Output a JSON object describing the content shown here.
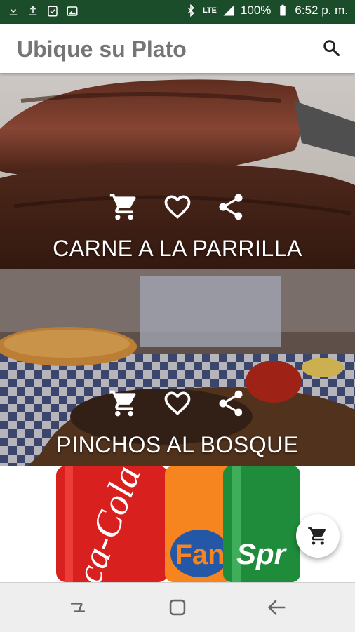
{
  "status_bar": {
    "network": "LTE",
    "battery": "100%",
    "time": "6:52 p. m."
  },
  "app_bar": {
    "title": "Ubique su Plato"
  },
  "dishes": [
    {
      "name": "CARNE A LA PARRILLA"
    },
    {
      "name": "PINCHOS AL BOSQUE"
    },
    {
      "name": ""
    }
  ],
  "icons": {
    "cart": "shopping-cart-icon",
    "favorite": "heart-icon",
    "share": "share-icon",
    "search": "search-icon"
  },
  "colors": {
    "status_bar": "#1b4d2b",
    "title": "#757575",
    "nav_bar": "#eeeeee"
  }
}
